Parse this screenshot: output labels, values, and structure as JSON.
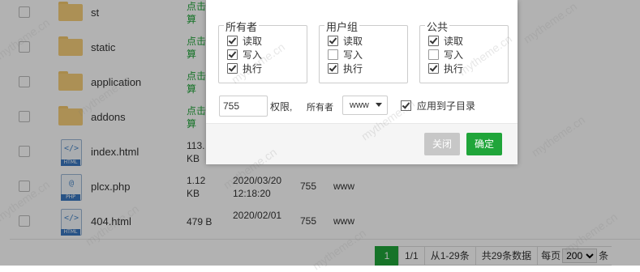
{
  "files": [
    {
      "name": "st",
      "type": "folder",
      "size": "点击计算"
    },
    {
      "name": "static",
      "type": "folder",
      "size": "点击计算"
    },
    {
      "name": "application",
      "type": "folder",
      "size": "点击计算"
    },
    {
      "name": "addons",
      "type": "folder",
      "size": "点击计算"
    },
    {
      "name": "index.html",
      "type": "html",
      "size_line1": "113.",
      "size_line2": "KB"
    },
    {
      "name": "plcx.php",
      "type": "php",
      "size_line1": "1.12",
      "size_line2": "KB",
      "mtime_line1": "2020/03/20",
      "mtime_line2": "12:18:20",
      "perm": "755",
      "owner": "www"
    },
    {
      "name": "404.html",
      "type": "html",
      "size_line1": "479 B",
      "mtime_line1": "2020/02/01",
      "perm": "755",
      "owner": "www"
    }
  ],
  "file_icons": {
    "html": {
      "symbol": "</>",
      "label": "HTML"
    },
    "php": {
      "symbol": "@",
      "label": "PHP"
    }
  },
  "calc_split": [
    "点击",
    "算"
  ],
  "pager": {
    "current": "1",
    "page_of": "1/1",
    "range": "从1-29条",
    "total": "共29条数据",
    "per_page_label": "每页",
    "per_page_value": "200",
    "per_page_unit": "条"
  },
  "dialog": {
    "groups": [
      {
        "title": "所有者",
        "read": "读取",
        "write": "写入",
        "exec": "执行",
        "read_on": true,
        "write_on": true,
        "exec_on": true
      },
      {
        "title": "用户组",
        "read": "读取",
        "write": "写入",
        "exec": "执行",
        "read_on": true,
        "write_on": false,
        "exec_on": true
      },
      {
        "title": "公共",
        "read": "读取",
        "write": "写入",
        "exec": "执行",
        "read_on": true,
        "write_on": false,
        "exec_on": true
      }
    ],
    "permission_value": "755",
    "permission_label": "权限,",
    "owner_label": "所有者",
    "owner_value": "www",
    "apply_subdir_label": "应用到子目录",
    "close_label": "关闭",
    "confirm_label": "确定"
  },
  "watermark": "mytheme.cn",
  "colors": {
    "accent": "#20a53a",
    "folder": "#f6cf7a"
  }
}
